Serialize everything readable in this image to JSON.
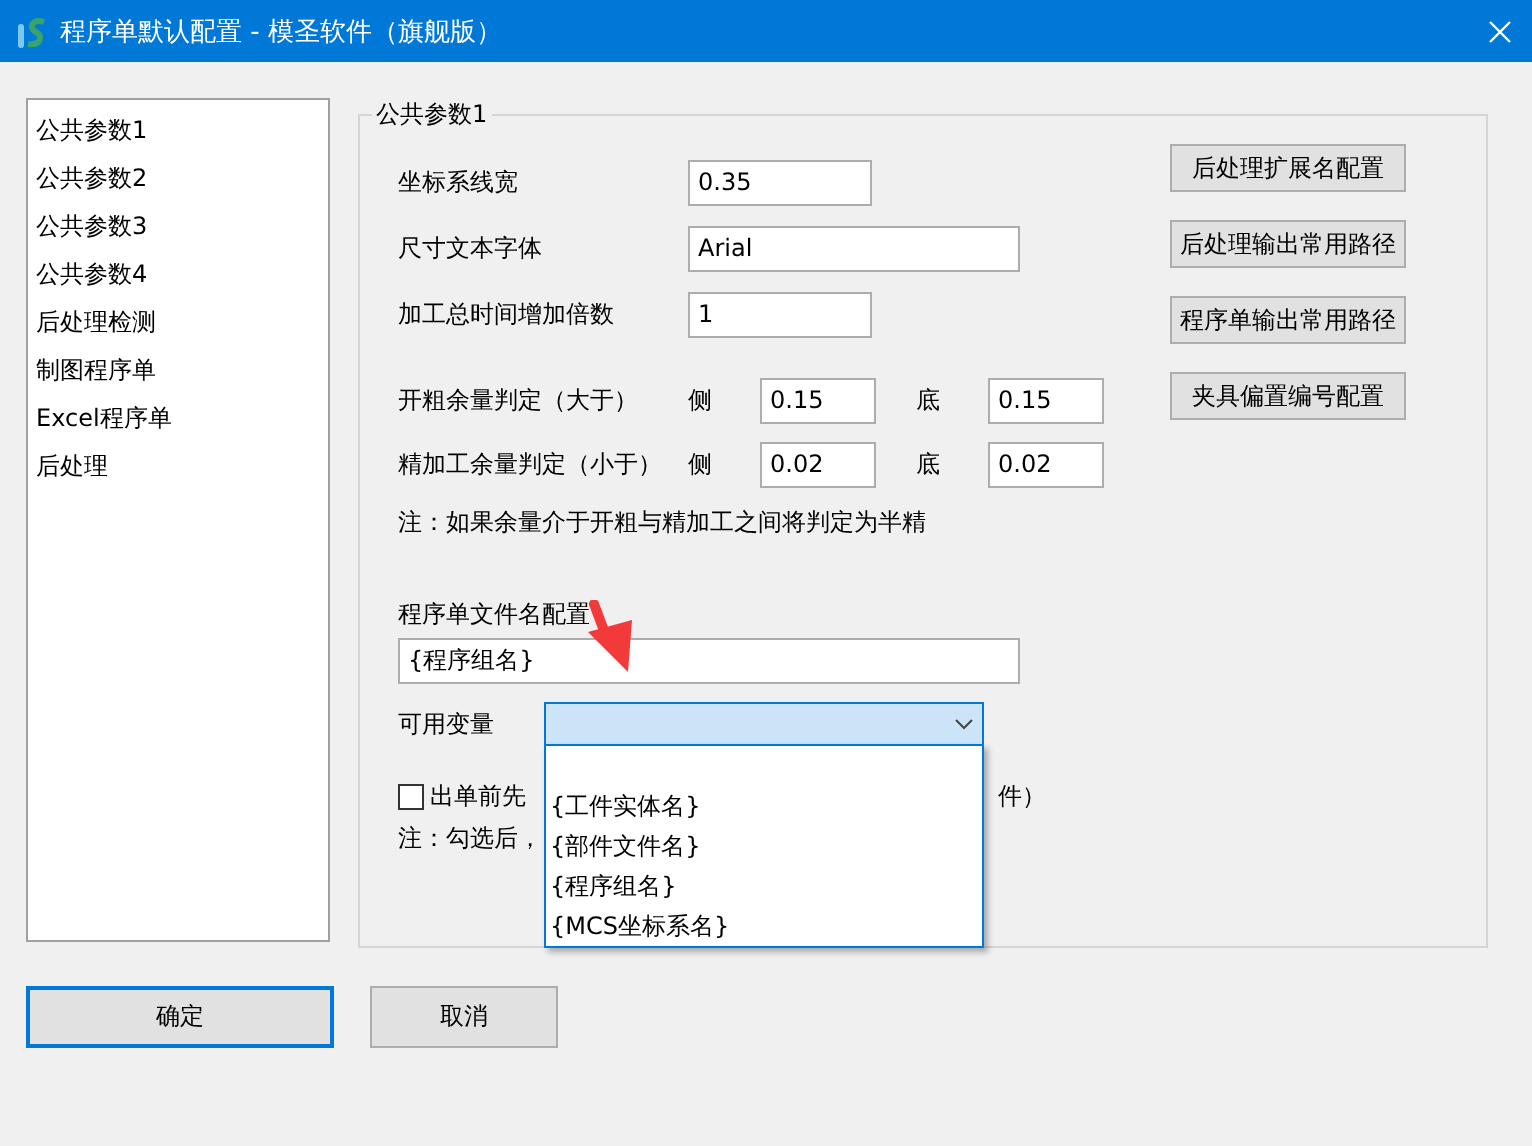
{
  "window": {
    "title": "程序单默认配置 - 模圣软件（旗舰版）"
  },
  "sidebar": {
    "items": [
      {
        "label": "公共参数1",
        "selected": false
      },
      {
        "label": "公共参数2",
        "selected": false
      },
      {
        "label": "公共参数3",
        "selected": false
      },
      {
        "label": "公共参数4",
        "selected": false
      },
      {
        "label": "后处理检测",
        "selected": false
      },
      {
        "label": "制图程序单",
        "selected": false
      },
      {
        "label": "Excel程序单",
        "selected": false
      },
      {
        "label": "后处理",
        "selected": false
      }
    ]
  },
  "group": {
    "title": "公共参数1",
    "fields": [
      {
        "label": "坐标系线宽",
        "value": "0.35",
        "kind": "short"
      },
      {
        "label": "尺寸文本字体",
        "value": "Arial",
        "kind": "long"
      },
      {
        "label": "加工总时间增加倍数",
        "value": "1",
        "kind": "short"
      }
    ],
    "allowance_rows": [
      {
        "label": "开粗余量判定（大于）",
        "side_label": "侧",
        "side_value": "0.15",
        "bottom_label": "底",
        "bottom_value": "0.15"
      },
      {
        "label": "精加工余量判定（小于）",
        "side_label": "侧",
        "side_value": "0.02",
        "bottom_label": "底",
        "bottom_value": "0.02"
      }
    ],
    "note": "注：如果余量介于开粗与精加工之间将判定为半精",
    "filename": {
      "label": "程序单文件名配置",
      "value": "{程序组名}"
    },
    "variables": {
      "label": "可用变量",
      "expanded": true,
      "options": [
        {
          "label": "{工件实体名}",
          "selected": false
        },
        {
          "label": "{部件文件名}",
          "selected": false
        },
        {
          "label": "{程序组名}",
          "selected": false
        },
        {
          "label": "{MCS坐标系名}",
          "selected": false
        }
      ]
    },
    "checkbox": {
      "label": "出单前先",
      "checked": false,
      "tail": "件）"
    },
    "checkbox_note": "注：勾选后，",
    "side_buttons": [
      "后处理扩展名配置",
      "后处理输出常用路径",
      "程序单输出常用路径",
      "夹具偏置编号配置"
    ]
  },
  "footer_buttons": [
    {
      "label": "确定",
      "default": true
    },
    {
      "label": "取消",
      "default": false
    }
  ]
}
